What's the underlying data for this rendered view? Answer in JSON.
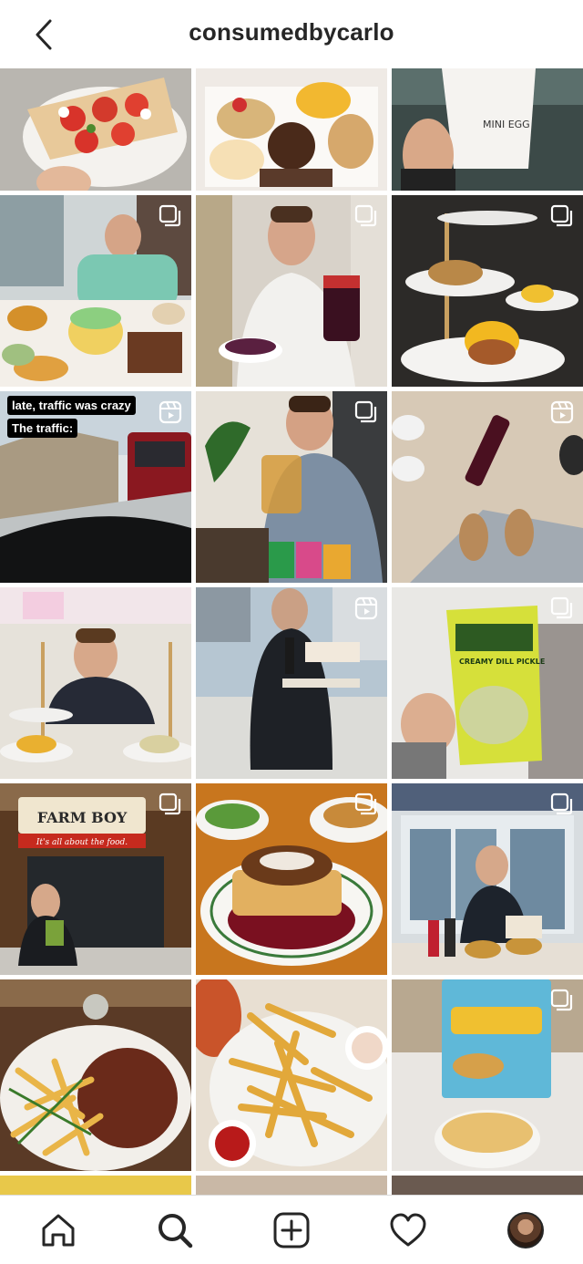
{
  "header": {
    "username": "consumedbycarlo",
    "back_icon": "chevron-left-icon"
  },
  "grid": {
    "posts": [
      {
        "name": "post-pizza",
        "icon": null
      },
      {
        "name": "post-pastries",
        "icon": null
      },
      {
        "name": "post-mini-egg-drink",
        "icon": null,
        "text": "MINI EGG"
      },
      {
        "name": "post-birthday-spread",
        "icon": "carousel-icon"
      },
      {
        "name": "post-jam-jar",
        "icon": "carousel-icon"
      },
      {
        "name": "post-brunch-tower",
        "icon": "carousel-icon"
      },
      {
        "name": "post-traffic-reel",
        "icon": "reel-icon",
        "captions": [
          "late, traffic was crazy",
          "The traffic:"
        ]
      },
      {
        "name": "post-tea-mug",
        "icon": "carousel-icon"
      },
      {
        "name": "post-wine-slippers",
        "icon": "reel-icon"
      },
      {
        "name": "post-high-tea",
        "icon": null
      },
      {
        "name": "post-takeout-reel",
        "icon": "reel-icon"
      },
      {
        "name": "post-pickle-chips",
        "icon": "carousel-icon",
        "text": "CREAMY DILL PICKLE"
      },
      {
        "name": "post-farm-boy",
        "icon": "carousel-icon",
        "sign": "FARM BOY",
        "slogan": "It's all about the food."
      },
      {
        "name": "post-french-toast",
        "icon": "carousel-icon"
      },
      {
        "name": "post-burgers",
        "icon": "carousel-icon"
      },
      {
        "name": "post-steak-frites",
        "icon": null
      },
      {
        "name": "post-fries",
        "icon": null
      },
      {
        "name": "post-cereal",
        "icon": "carousel-icon"
      }
    ]
  },
  "tabbar": {
    "home": "home-icon",
    "search": "search-icon",
    "create": "add-post-icon",
    "activity": "heart-icon",
    "profile": "profile-avatar"
  },
  "colors": {
    "text": "#262626",
    "divider": "#dbdbdb"
  }
}
